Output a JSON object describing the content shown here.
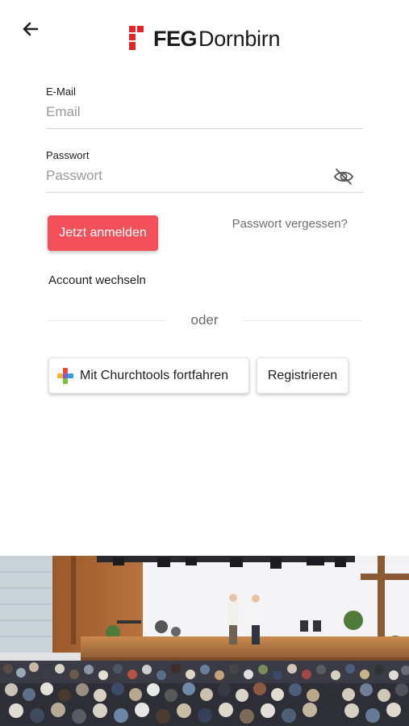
{
  "header": {
    "back_icon": "arrow-left-icon",
    "logo": {
      "bold": "FEG",
      "regular": "Dornbirn",
      "brand_color": "#e3242b"
    }
  },
  "form": {
    "email": {
      "label": "E-Mail",
      "placeholder": "Email",
      "value": ""
    },
    "password": {
      "label": "Passwort",
      "placeholder": "Passwort",
      "value": "",
      "toggle_icon": "eye-off-icon"
    }
  },
  "actions": {
    "login_label": "Jetzt anmelden",
    "login_color": "#f4505a",
    "forgot_label": "Passwort vergessen?",
    "switch_account_label": "Account wechseln",
    "divider_label": "oder",
    "churchtools_label": "Mit Churchtools fortfahren",
    "churchtools_icon": "churchtools-logo-icon",
    "register_label": "Registrieren"
  },
  "hero": {
    "image": "church-service-photo"
  }
}
